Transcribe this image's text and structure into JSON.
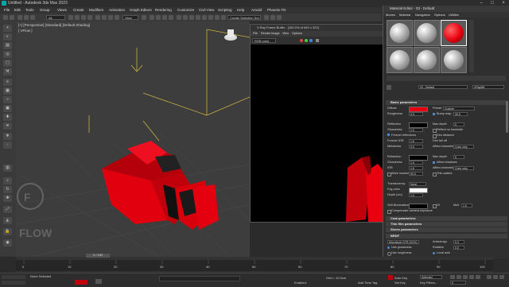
{
  "window": {
    "title": "Untitled - Autodesk 3ds Max 2023"
  },
  "menubar": [
    "File",
    "Edit",
    "Tools",
    "Group",
    "Views",
    "Create",
    "Modifiers",
    "Animation",
    "Graph Editors",
    "Rendering",
    "Customize",
    "Civil View",
    "Scripting",
    "Help",
    "Arnold",
    "Phoenix FD"
  ],
  "toolbar": {
    "filter_select": "All",
    "view_select": "View",
    "selection_set": "Create Selection Set"
  },
  "viewport": {
    "label": "[+] [Perspective] [Standard] [Default Shading]",
    "sublabel": "[ VFlow ]",
    "watermark": "FLOW"
  },
  "vfb": {
    "title": "V-Ray Frame Buffer - [100.0% of 640 x 320]",
    "menu": [
      "File",
      "Render",
      "Image",
      "View",
      "Options"
    ],
    "channel": "RGB color"
  },
  "material_editor": {
    "title": "Material Editor - 03 - Default",
    "menu": [
      "Modes",
      "Material",
      "Navigation",
      "Options",
      "Utilities"
    ],
    "material_name": "03 - Default",
    "material_type": "VRayMtl",
    "rollouts": {
      "basic": "Basic parameters",
      "coat": "Coat parameters",
      "thin_film": "Thin film parameters",
      "sheen": "Sheen parameters",
      "brdf": "BRDF"
    },
    "params": {
      "diffuse": "Diffuse",
      "preset": "Preset",
      "preset_val": "Custom",
      "roughness": "Roughness",
      "roughness_val": "0.0",
      "bump_map": "Bump map",
      "bump_val": "30.0",
      "reflection": "Reflection",
      "max_depth": "Max depth",
      "max_depth_val": "5",
      "glossiness": "Glossiness",
      "glossiness_val": "1.0",
      "reflect_backside": "Reflect on backside",
      "fresnel": "Fresnel reflections",
      "dim_distance": "Dim distance",
      "fresnel_ior": "Fresnel IOR",
      "fresnel_ior_val": "1.6",
      "dim_falloff": "Dim fall off",
      "metalness": "Metalness",
      "metalness_val": "0.0",
      "affect_channels": "Affect channels",
      "affect_channels_val": "Color only",
      "refraction": "Refraction",
      "refr_max_depth": "Max depth",
      "refr_max_depth_val": "5",
      "refr_glossiness": "Glossiness",
      "refr_glossiness_val": "1.0",
      "affect_shadows": "Affect shadows",
      "ior": "IOR",
      "ior_val": "1.6",
      "refr_affect_channels": "Affect channels",
      "refr_affect_channels_val": "Color only",
      "abbe": "Abbe number",
      "abbe_val": "50.0",
      "thin_walled": "Thin-walled",
      "translucency": "Translucency",
      "translucency_val": "None",
      "fog_color": "Fog color",
      "fog_depth": "Depth (cm)",
      "fog_depth_val": "1.0",
      "self_illum": "Self-illumination",
      "gi": "GI",
      "mult": "Mult",
      "mult_val": "1.0",
      "compensate": "Compensate camera exposure",
      "brdf_type": "Microfacet GTR (GGX)",
      "anisotropy": "Anisotropy",
      "anisotropy_val": "0.0",
      "rotation": "Rotation",
      "rotation_val": "0.0",
      "use_glossiness": "Use glossiness",
      "use_roughness": "Use roughness",
      "local_axis": "Local axis"
    }
  },
  "timeline": {
    "frame_counter": "0 / 100",
    "ticks": [
      "0",
      "10",
      "20",
      "30",
      "40",
      "50",
      "60",
      "70",
      "80",
      "90",
      "100"
    ]
  },
  "status": {
    "selection": "None Selected",
    "auto_key": "Auto Key",
    "selected": "Selected",
    "set_key": "Set Key",
    "key_filters": "Key Filters...",
    "add_time_tag": "Add Time Tag",
    "grid": "Grid = 10.0cm",
    "enabled": "Enabled:",
    "frame": "0"
  },
  "colors": {
    "accent_red": "#e8000e",
    "panel_bg": "#2f2f2f",
    "viewport_bg": "#3d3d3d"
  }
}
